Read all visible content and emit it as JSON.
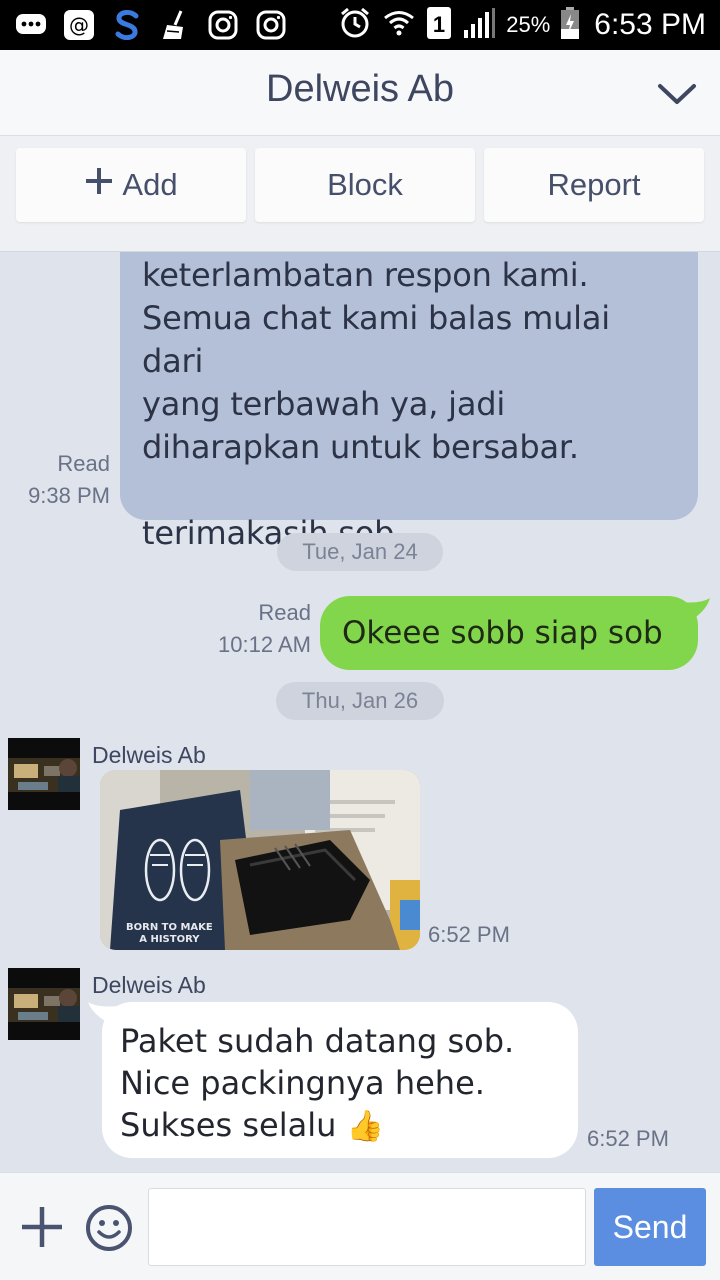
{
  "status_bar": {
    "battery_percent": "25%",
    "time": "6:53 PM",
    "sim_slot": "1",
    "icons": [
      "messages-icon",
      "at-icon",
      "swype-icon",
      "cleaner-icon",
      "instagram-icon",
      "instagram-icon",
      "alarm-icon",
      "wifi-icon",
      "sim-icon",
      "signal-icon",
      "battery-icon"
    ]
  },
  "header": {
    "title": "Delweis Ab"
  },
  "actions": {
    "add_label": "Add",
    "block_label": "Block",
    "report_label": "Report"
  },
  "messages": {
    "first": {
      "text": "keterlambatan respon kami.\nSemua chat kami balas mulai dari\nyang terbawah ya, jadi\ndiharapkan untuk bersabar.\n\nterimakasih sob.",
      "status": "Read",
      "time": "9:38 PM"
    },
    "date_1": "Tue, Jan 24",
    "sent": {
      "text": "Okeee sobb siap sob",
      "status": "Read",
      "time": "10:12 AM"
    },
    "date_2": "Thu, Jan 26",
    "photo_msg": {
      "sender": "Delweis Ab",
      "caption": "BORN TO MAKE\nA HISTORY",
      "time": "6:52 PM"
    },
    "text_msg": {
      "sender": "Delweis Ab",
      "text": "Paket sudah datang sob.\nNice packingnya hehe.\nSukses selalu",
      "emoji": "👍",
      "time": "6:52 PM"
    }
  },
  "input_bar": {
    "placeholder": "",
    "value": "",
    "send_label": "Send"
  },
  "colors": {
    "sent_bubble": "#82d64b",
    "received_bubble_own": "#b4bfd8",
    "send_button": "#5b8ee0",
    "header_text": "#3e4660"
  }
}
